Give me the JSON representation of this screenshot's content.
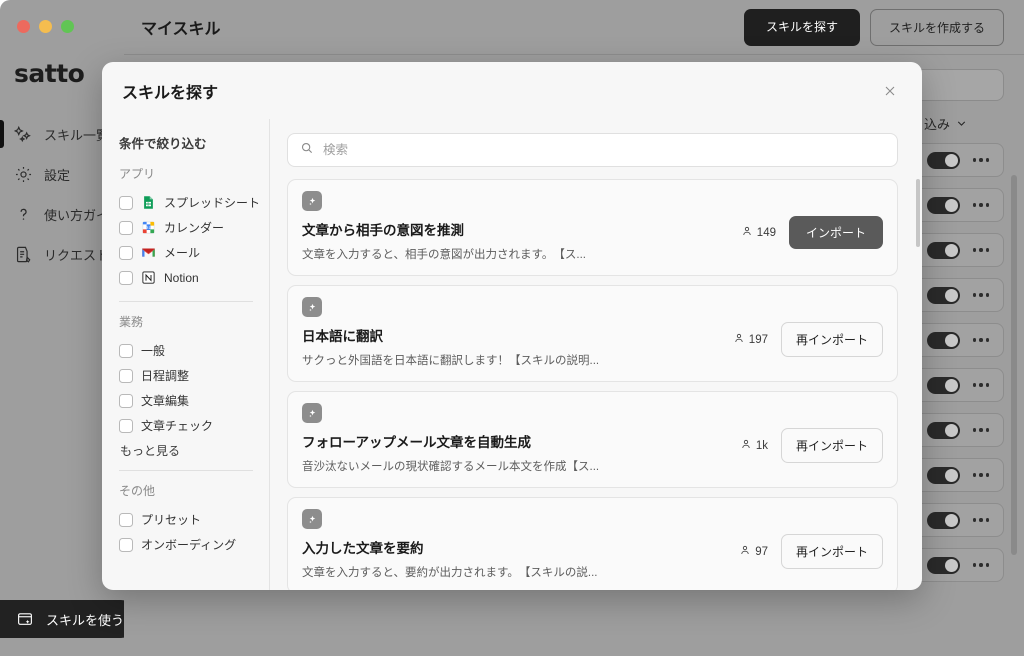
{
  "window": {
    "traffic_lights": [
      "close",
      "minimize",
      "maximize"
    ],
    "brand": "satto"
  },
  "sidebar": {
    "items": [
      {
        "label": "スキル一覧",
        "icon": "sparkles-icon",
        "active": true
      },
      {
        "label": "設定",
        "icon": "gear-icon",
        "active": false
      },
      {
        "label": "使い方ガイ",
        "icon": "question-mark-icon",
        "active": false
      },
      {
        "label": "リクエスト",
        "icon": "document-edit-icon",
        "active": false
      }
    ],
    "use_skill_button": {
      "label": "スキルを使う",
      "icon": "skill-card-icon"
    }
  },
  "topbar": {
    "title": "マイスキル",
    "find_skill_button": "スキルを探す",
    "create_skill_button": "スキルを作成する"
  },
  "background": {
    "filter_dropdown_label": "り込み",
    "row_count": 10
  },
  "modal": {
    "title": "スキルを探す",
    "close_icon": "close-icon",
    "filters": {
      "heading": "条件で絞り込む",
      "groups": [
        {
          "label": "アプリ",
          "items": [
            {
              "label": "スプレッドシート",
              "icon": "google-sheets-icon",
              "checked": false
            },
            {
              "label": "カレンダー",
              "icon": "google-calendar-icon",
              "checked": false
            },
            {
              "label": "メール",
              "icon": "gmail-icon",
              "checked": false
            },
            {
              "label": "Notion",
              "icon": "notion-icon",
              "checked": false
            }
          ]
        },
        {
          "label": "業務",
          "items": [
            {
              "label": "一般",
              "checked": false
            },
            {
              "label": "日程調整",
              "checked": false
            },
            {
              "label": "文章編集",
              "checked": false
            },
            {
              "label": "文章チェック",
              "checked": false
            }
          ],
          "more_label": "もっと見る"
        },
        {
          "label": "その他",
          "items": [
            {
              "label": "プリセット",
              "checked": false
            },
            {
              "label": "オンボーディング",
              "checked": false
            }
          ]
        }
      ]
    },
    "search": {
      "placeholder": "検索",
      "value": "",
      "icon": "search-icon"
    },
    "cards": [
      {
        "title": "文章から相手の意図を推測",
        "description": "文章を入力すると、相手の意図が出力されます。　【ス...",
        "users": "149",
        "action_label": "インポート",
        "action_style": "primary",
        "icon": "skill-sparkle-icon"
      },
      {
        "title": "日本語に翻訳",
        "description": "サクっと外国語を日本語に翻訳します！【スキルの説明...",
        "users": "197",
        "action_label": "再インポート",
        "action_style": "outline",
        "icon": "skill-sparkle-icon"
      },
      {
        "title": "フォローアップメール文章を自動生成",
        "description": "音沙汰ないメールの現状確認するメール本文を作成【ス...",
        "users": "1k",
        "action_label": "再インポート",
        "action_style": "outline",
        "icon": "skill-sparkle-icon"
      },
      {
        "title": "入力した文章を要約",
        "description": "文章を入力すると、要約が出力されます。　【スキルの説...",
        "users": "97",
        "action_label": "再インポート",
        "action_style": "outline",
        "icon": "skill-sparkle-icon"
      }
    ]
  },
  "colors": {
    "accent_dark": "#1f1f1f",
    "modal_bg": "#f7f7f7",
    "card_bg": "#fafafa",
    "import_button": "#5a5a5a",
    "sheets_green": "#0f9d58",
    "calendar_blue": "#4285f4",
    "gmail_red": "#ea4335"
  }
}
